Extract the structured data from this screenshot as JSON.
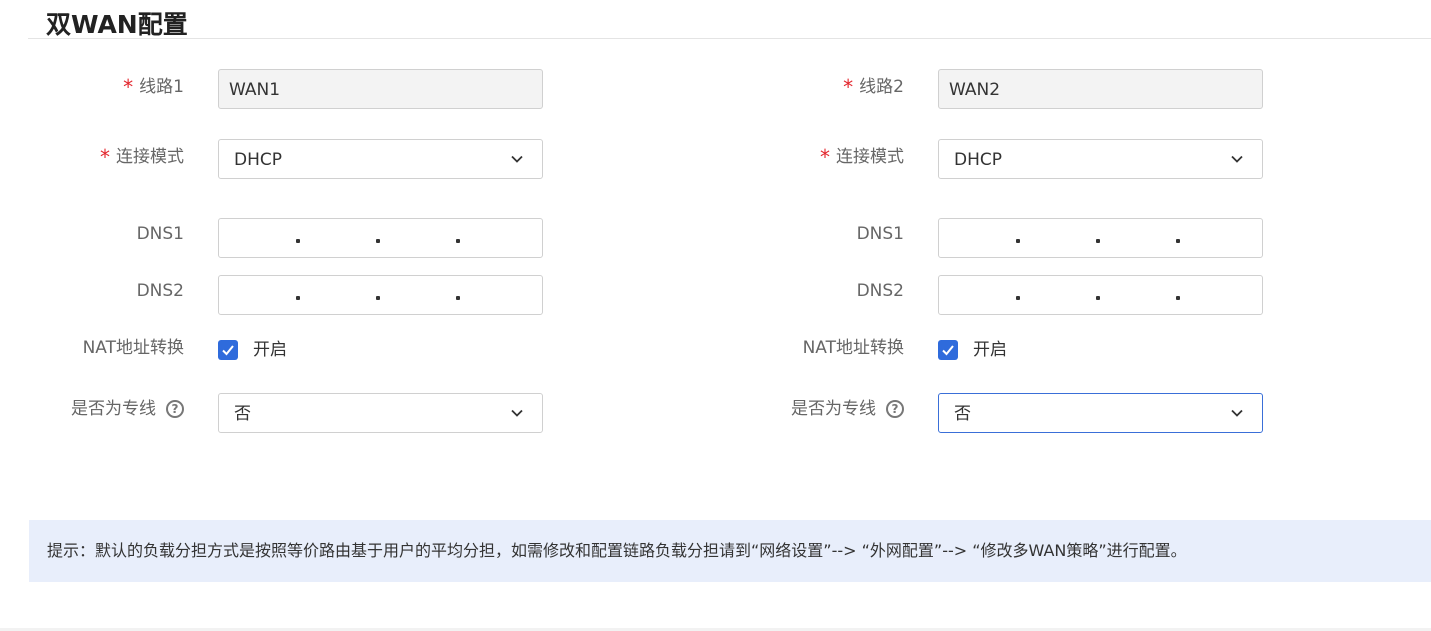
{
  "title": "双WAN配置",
  "icons": {
    "chevron": "chevron-down-icon",
    "help": "help-circle-icon",
    "check": "check-icon"
  },
  "colors": {
    "required": "#e3262d",
    "checkbox": "#2f6bdc",
    "focus_border": "#3a6fd8",
    "notice_bg": "#e8eefb"
  },
  "wan1": {
    "line_label": "线路1",
    "line_value": "WAN1",
    "mode_label": "连接模式",
    "mode_value": "DHCP",
    "dns1_label": "DNS1",
    "dns1_value": [
      "",
      "",
      "",
      ""
    ],
    "dns2_label": "DNS2",
    "dns2_value": [
      "",
      "",
      "",
      ""
    ],
    "nat_label": "NAT地址转换",
    "nat_option": "开启",
    "nat_checked": true,
    "dedicated_label": "是否为专线",
    "dedicated_value": "否"
  },
  "wan2": {
    "line_label": "线路2",
    "line_value": "WAN2",
    "mode_label": "连接模式",
    "mode_value": "DHCP",
    "dns1_label": "DNS1",
    "dns1_value": [
      "",
      "",
      "",
      ""
    ],
    "dns2_label": "DNS2",
    "dns2_value": [
      "",
      "",
      "",
      ""
    ],
    "nat_label": "NAT地址转换",
    "nat_option": "开启",
    "nat_checked": true,
    "dedicated_label": "是否为专线",
    "dedicated_value": "否"
  },
  "required_mark": "*",
  "help_glyph": "?",
  "notice": "提示：默认的负载分担方式是按照等价路由基于用户的平均分担，如需修改和配置链路负载分担请到“网络设置”--> “外网配置”--> “修改多WAN策略”进行配置。"
}
